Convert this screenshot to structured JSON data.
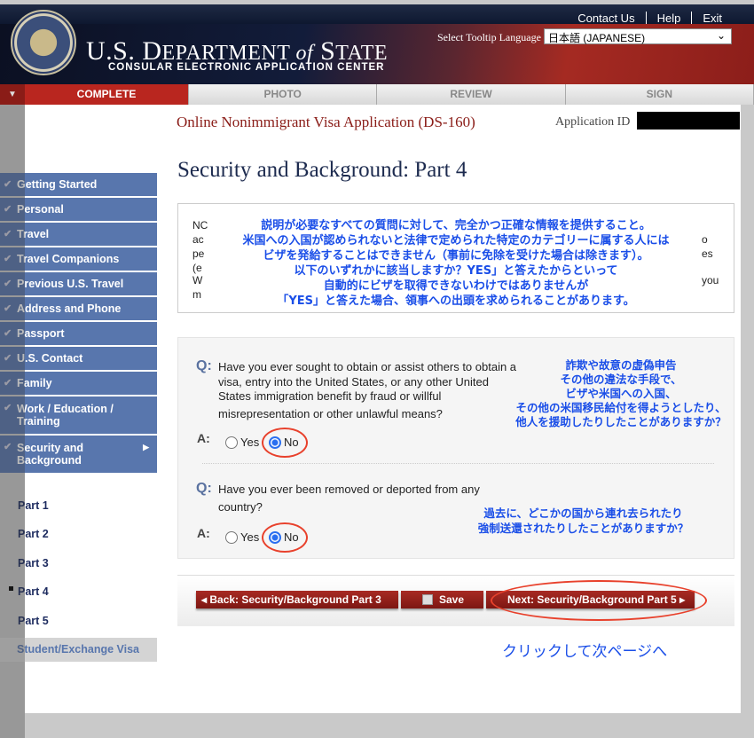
{
  "header": {
    "top_links": [
      "Contact Us",
      "Help",
      "Exit"
    ],
    "dept_title_1": "U.S. D",
    "dept_title_2": "EPARTMENT ",
    "dept_of": "of",
    "dept_title_3": " S",
    "dept_title_4": "TATE",
    "subtitle": "CONSULAR ELECTRONIC APPLICATION CENTER",
    "tooltip_label": "Select Tooltip Language",
    "tooltip_value": "日本語 (JAPANESE)"
  },
  "steps": [
    "COMPLETE",
    "PHOTO",
    "REVIEW",
    "SIGN"
  ],
  "app": {
    "title": "Online Nonimmigrant Visa Application (DS-160)",
    "id_label": "Application ID"
  },
  "page_title": "Security and Background: Part 4",
  "note": {
    "left_fragments": [
      "NC",
      "ac",
      "pe",
      "(e",
      "W",
      "m"
    ],
    "right_fragments": [
      "o",
      "es",
      "you"
    ],
    "jp_lines": [
      "説明が必要なすべての質問に対して、完全かつ正確な情報を提供すること。",
      "米国への入国が認められないと法律で定められた特定のカテゴリーに属する人には",
      "ビザを発給することはできません（事前に免除を受けた場合は除きます）。",
      "以下のいずれかに該当しますか？YES」と答えたからといって",
      "自動的にビザを取得できないわけではありませんが",
      "「YES」と答えた場合、領事への出頭を求められることがあります。"
    ]
  },
  "questions": [
    {
      "q_label": "Q:",
      "a_label": "A:",
      "lines": [
        "Have you ever sought to obtain or assist others to obtain a",
        "visa, entry into the United States, or any other United",
        "States immigration benefit by fraud or willful",
        "misrepresentation or other unlawful means?"
      ],
      "yes": "Yes",
      "no": "No",
      "selected": "No",
      "jp": [
        "詐欺や故意の虚偽申告",
        "その他の違法な手段で、",
        "ビザや米国への入国、",
        "その他の米国移民給付を得ようとしたり、",
        "他人を援助したりしたことがありますか？"
      ]
    },
    {
      "q_label": "Q:",
      "a_label": "A:",
      "lines": [
        "Have you ever been removed or deported from any",
        "country?"
      ],
      "yes": "Yes",
      "no": "No",
      "selected": "No",
      "jp": [
        "過去に、どこかの国から連れ去られたり",
        "強制送還されたりしたことがありますか？"
      ]
    }
  ],
  "buttons": {
    "back": "Back: Security/Background Part 3",
    "save": "Save",
    "next": "Next: Security/Background Part 5"
  },
  "click_note": "クリックして次ページへ",
  "sidebar": {
    "items": [
      "Getting Started",
      "Personal",
      "Travel",
      "Travel Companions",
      "Previous U.S. Travel",
      "Address and Phone",
      "Passport",
      "U.S. Contact",
      "Family",
      "Work / Education / Training",
      "Security and Background"
    ],
    "parts": [
      "Part 1",
      "Part 2",
      "Part 3",
      "Part 4",
      "Part 5"
    ],
    "current_part": "Part 4",
    "student": "Student/Exchange Visa"
  },
  "colors": {
    "sidebar": "#5876ad",
    "active_step": "#b9261f",
    "annotation": "#1a4ee8",
    "highlight_circle": "#e8412c"
  }
}
